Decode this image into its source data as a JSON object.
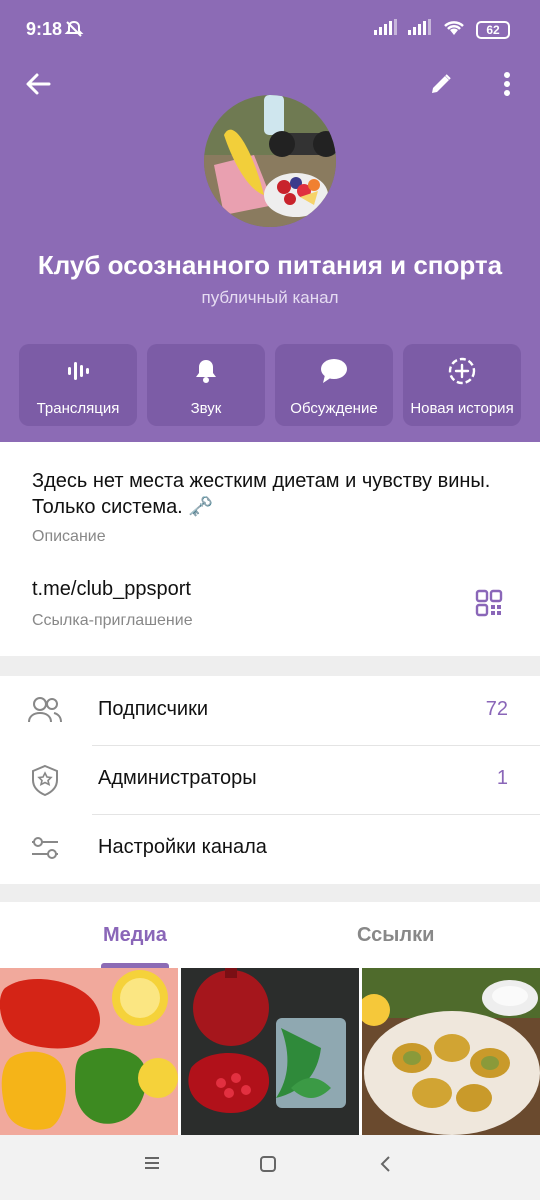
{
  "status_bar": {
    "time": "9:18",
    "battery": "62"
  },
  "channel": {
    "title": "Клуб осознанного питания и спорта",
    "subtitle": "публичный канал"
  },
  "actions": [
    {
      "label": "Трансляция",
      "icon": "broadcast-icon"
    },
    {
      "label": "Звук",
      "icon": "bell-icon"
    },
    {
      "label": "Обсуждение",
      "icon": "chat-bubble-icon"
    },
    {
      "label": "Новая история",
      "icon": "new-story-icon"
    }
  ],
  "info": {
    "description": "Здесь нет места жестким диетам и чувству вины. Только система. 🗝️",
    "description_caption": "Описание",
    "link": "t.me/club_ppsport",
    "link_caption": "Ссылка-приглашение"
  },
  "menu": [
    {
      "label": "Подписчики",
      "count": "72",
      "icon": "subscribers-icon"
    },
    {
      "label": "Администраторы",
      "count": "1",
      "icon": "admin-shield-icon"
    },
    {
      "label": "Настройки канала",
      "count": "",
      "icon": "settings-sliders-icon"
    }
  ],
  "tabs": [
    {
      "label": "Медиа",
      "active": true
    },
    {
      "label": "Ссылки",
      "active": false
    }
  ],
  "media": [
    "peppers-lemons-photo",
    "pomegranate-water-photo",
    "zucchini-dish-photo"
  ],
  "colors": {
    "header": "#8c6bb5",
    "accent": "#8a66b8",
    "action_bg": "#7c5ca6"
  }
}
